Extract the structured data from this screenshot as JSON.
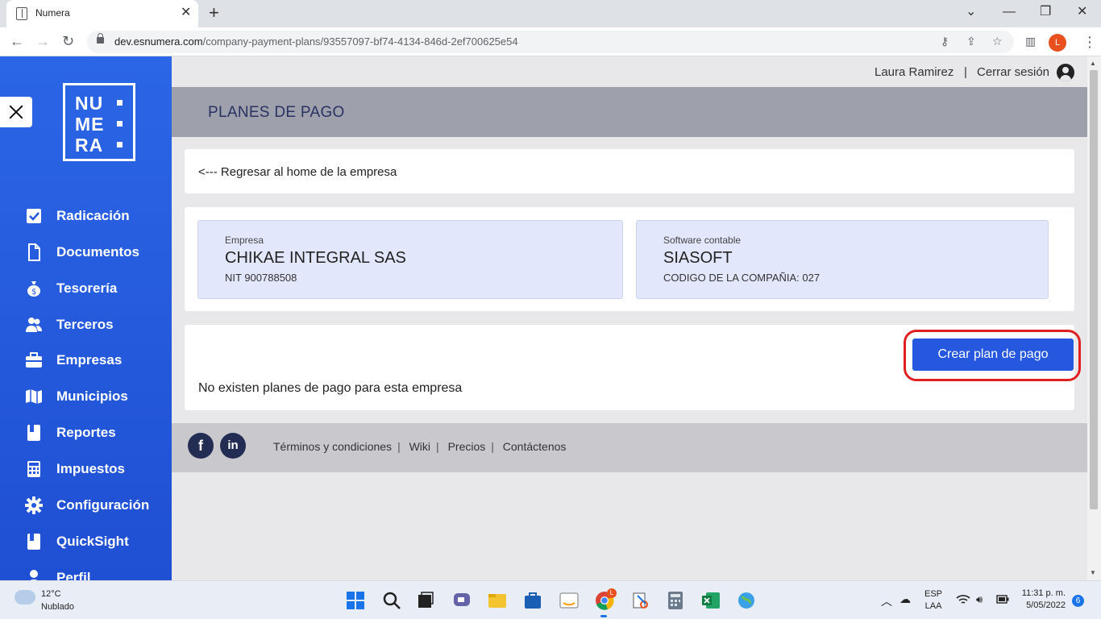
{
  "browser": {
    "tab_title": "Numera",
    "url_host": "dev.esnumera.com",
    "url_path": "/company-payment-plans/93557097-bf74-4134-846d-2ef700625e54",
    "profile_initial": "L"
  },
  "sidebar": {
    "logo": {
      "line1": "NU",
      "line2": "ME",
      "line3": "RA"
    },
    "items": [
      {
        "label": "Radicación",
        "icon": "checkbox-icon"
      },
      {
        "label": "Documentos",
        "icon": "document-icon"
      },
      {
        "label": "Tesorería",
        "icon": "money-bag-icon"
      },
      {
        "label": "Terceros",
        "icon": "users-icon"
      },
      {
        "label": "Empresas",
        "icon": "briefcase-icon"
      },
      {
        "label": "Municipios",
        "icon": "map-icon"
      },
      {
        "label": "Reportes",
        "icon": "book-icon"
      },
      {
        "label": "Impuestos",
        "icon": "calculator-icon"
      },
      {
        "label": "Configuración",
        "icon": "gear-icon"
      },
      {
        "label": "QuickSight",
        "icon": "book-icon"
      },
      {
        "label": "Perfil",
        "icon": "user-icon"
      }
    ]
  },
  "header": {
    "user_name": "Laura Ramirez",
    "separator": "|",
    "logout": "Cerrar sesión",
    "page_title": "PLANES DE PAGO"
  },
  "main": {
    "back_link": "<--- Regresar al home de la empresa",
    "company": {
      "caption": "Empresa",
      "name": "CHIKAE INTEGRAL SAS",
      "nit": "NIT 900788508"
    },
    "software": {
      "caption": "Software contable",
      "name": "SIASOFT",
      "code": "CODIGO DE LA COMPAÑIA: 027"
    },
    "create_button": "Crear plan de pago",
    "empty_message": "No existen planes de pago para esta empresa"
  },
  "footer": {
    "facebook": "f",
    "linkedin": "in",
    "links": [
      "Términos y condiciones",
      "Wiki",
      "Precios",
      "Contáctenos"
    ],
    "sep": "|"
  },
  "taskbar": {
    "temperature": "12°C",
    "weather": "Nublado",
    "lang1": "ESP",
    "lang2": "LAA",
    "time": "11:31 p. m.",
    "date": "5/05/2022",
    "notifications": "6",
    "chrome_badge": "L"
  }
}
